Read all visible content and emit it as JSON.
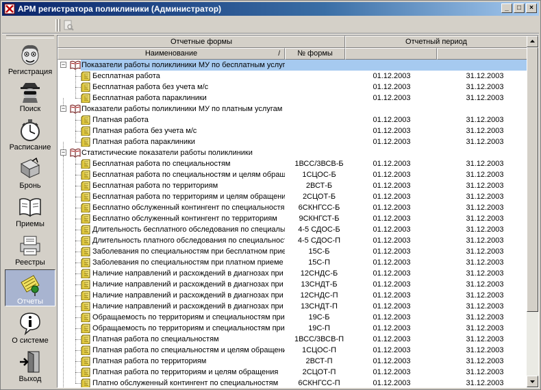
{
  "window": {
    "title": "АРМ регистратора поликлиники (Администратор)",
    "buttons": {
      "minimize": "_",
      "maximize": "□",
      "close": "×"
    }
  },
  "sidebar": {
    "items": [
      {
        "label": "Регистрация",
        "icon": "face-icon"
      },
      {
        "label": "Поиск",
        "icon": "spy-icon"
      },
      {
        "label": "Расписание",
        "icon": "stopwatch-icon"
      },
      {
        "label": "Бронь",
        "icon": "booking-icon"
      },
      {
        "label": "Приемы",
        "icon": "book-icon"
      },
      {
        "label": "Реестры",
        "icon": "registry-icon"
      },
      {
        "label": "Отчеты",
        "icon": "report-icon",
        "active": true
      },
      {
        "label": "О системе",
        "icon": "info-icon"
      },
      {
        "label": "Выход",
        "icon": "exit-icon"
      }
    ]
  },
  "grid": {
    "header_group": {
      "forms": "Отчетные формы",
      "period": "Отчетный период"
    },
    "columns": {
      "name": "Наименование",
      "code": "№ формы",
      "sort_mark": "/"
    },
    "rows": [
      {
        "level": 0,
        "name": "Показатели работы поликлиники МУ по бесплатным услугам",
        "selected": true
      },
      {
        "level": 1,
        "name": "Бесплатная работа",
        "code": "",
        "from": "01.12.2003",
        "to": "31.12.2003"
      },
      {
        "level": 1,
        "name": "Бесплатная работа без учета м/с",
        "code": "",
        "from": "01.12.2003",
        "to": "31.12.2003"
      },
      {
        "level": 1,
        "name": "Бесплатная работа параклиники",
        "code": "",
        "from": "01.12.2003",
        "to": "31.12.2003",
        "last": true
      },
      {
        "level": 0,
        "name": "Показатели работы поликлиники МУ по платным услугам"
      },
      {
        "level": 1,
        "name": "Платная работа",
        "code": "",
        "from": "01.12.2003",
        "to": "31.12.2003"
      },
      {
        "level": 1,
        "name": "Платная работа без учета м/с",
        "code": "",
        "from": "01.12.2003",
        "to": "31.12.2003"
      },
      {
        "level": 1,
        "name": "Платная работа параклиники",
        "code": "",
        "from": "01.12.2003",
        "to": "31.12.2003",
        "last": true
      },
      {
        "level": 0,
        "name": "Статистические показатели работы поликлиники"
      },
      {
        "level": 1,
        "name": "Бесплатная работа по специальностям",
        "code": "1ВСС/3ВСВ-Б",
        "from": "01.12.2003",
        "to": "31.12.2003"
      },
      {
        "level": 1,
        "name": "Бесплатная работа по специальностям и целям обращения",
        "code": "1СЦОС-Б",
        "from": "01.12.2003",
        "to": "31.12.2003"
      },
      {
        "level": 1,
        "name": "Бесплатная работа по территориям",
        "code": "2ВСТ-Б",
        "from": "01.12.2003",
        "to": "31.12.2003"
      },
      {
        "level": 1,
        "name": "Бесплатная работа по территориям и целям обращения",
        "code": "2СЦОТ-Б",
        "from": "01.12.2003",
        "to": "31.12.2003"
      },
      {
        "level": 1,
        "name": "Бесплатно обслуженный контингент по специальностям",
        "code": "6СКНГСС-Б",
        "from": "01.12.2003",
        "to": "31.12.2003"
      },
      {
        "level": 1,
        "name": "Бесплатно обслуженный контингент по территориям",
        "code": "9СКНГСТ-Б",
        "from": "01.12.2003",
        "to": "31.12.2003"
      },
      {
        "level": 1,
        "name": "Длительность бесплатного обследования по специальностям",
        "code": "4-5 СДОС-Б",
        "from": "01.12.2003",
        "to": "31.12.2003"
      },
      {
        "level": 1,
        "name": "Длительность платного обследования по специальностям",
        "code": "4-5 СДОС-П",
        "from": "01.12.2003",
        "to": "31.12.2003"
      },
      {
        "level": 1,
        "name": "Заболевания по специальностям при бесплатном приеме",
        "code": "15С-Б",
        "from": "01.12.2003",
        "to": "31.12.2003"
      },
      {
        "level": 1,
        "name": "Заболевания по специальностям при платном приеме",
        "code": "15С-П",
        "from": "01.12.2003",
        "to": "31.12.2003"
      },
      {
        "level": 1,
        "name": "Наличие направлений и расхождений в диагнозах при",
        "code": "12СНДС-Б",
        "from": "01.12.2003",
        "to": "31.12.2003"
      },
      {
        "level": 1,
        "name": "Наличие направлений и расхождений в диагнозах при",
        "code": "13СНДТ-Б",
        "from": "01.12.2003",
        "to": "31.12.2003"
      },
      {
        "level": 1,
        "name": "Наличие направлений и расхождений в диагнозах при",
        "code": "12СНДС-П",
        "from": "01.12.2003",
        "to": "31.12.2003"
      },
      {
        "level": 1,
        "name": "Наличие направлений и расхождений в диагнозах при",
        "code": "13СНДТ-П",
        "from": "01.12.2003",
        "to": "31.12.2003"
      },
      {
        "level": 1,
        "name": "Обращаемость по территориям и специальностям при",
        "code": "19С-Б",
        "from": "01.12.2003",
        "to": "31.12.2003"
      },
      {
        "level": 1,
        "name": "Обращаемость по территориям и специальностям при",
        "code": "19С-П",
        "from": "01.12.2003",
        "to": "31.12.2003"
      },
      {
        "level": 1,
        "name": "Платная работа по специальностям",
        "code": "1ВСС/3ВСВ-П",
        "from": "01.12.2003",
        "to": "31.12.2003"
      },
      {
        "level": 1,
        "name": "Платная работа по специальностям и целям обращения",
        "code": "1СЦОС-П",
        "from": "01.12.2003",
        "to": "31.12.2003"
      },
      {
        "level": 1,
        "name": "Платная работа по территориям",
        "code": "2ВСТ-П",
        "from": "01.12.2003",
        "to": "31.12.2003"
      },
      {
        "level": 1,
        "name": "Платная работа по территориям и целям обращения",
        "code": "2СЦОТ-П",
        "from": "01.12.2003",
        "to": "31.12.2003"
      },
      {
        "level": 1,
        "name": "Платно обслуженный контингент по специальностям",
        "code": "6СКНГСС-П",
        "from": "01.12.2003",
        "to": "31.12.2003"
      }
    ]
  },
  "colors": {
    "titlebar": "#0a246a",
    "selection": "#a6caf0",
    "face": "#d4d0c8"
  }
}
